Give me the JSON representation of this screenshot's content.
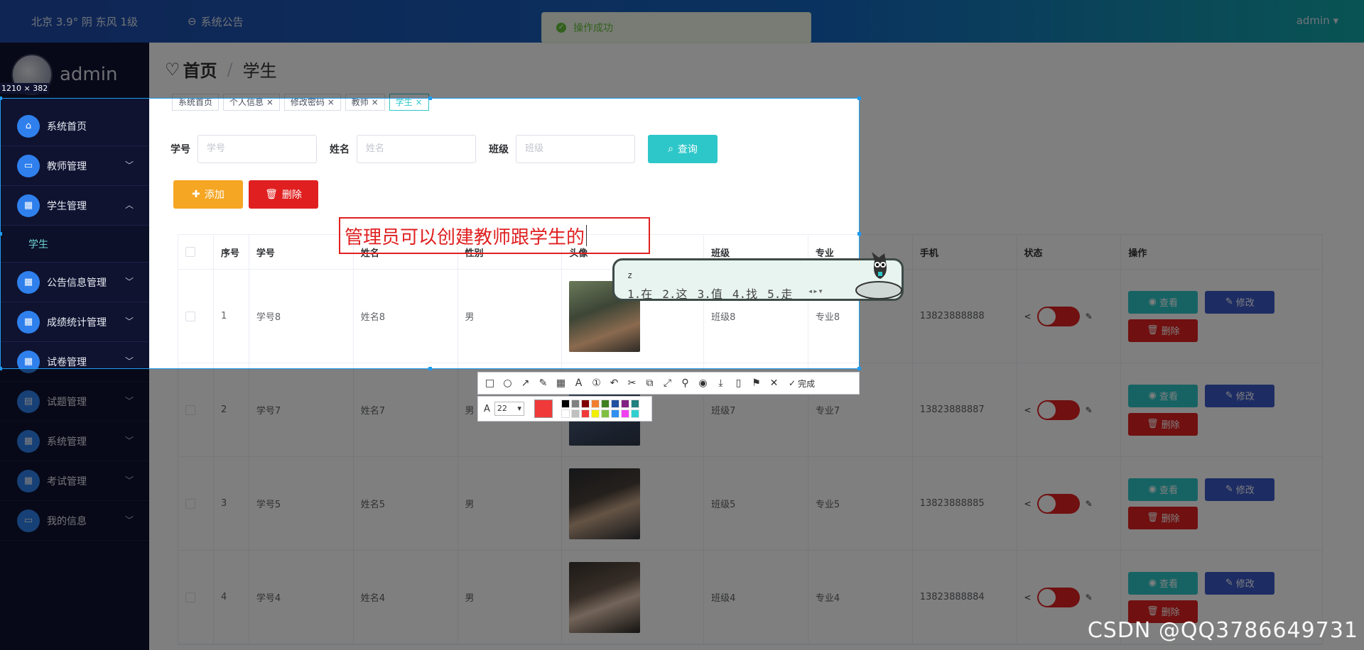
{
  "topbar": {
    "weather": "北京 3.9° 阴 东风 1级",
    "notice": "系统公告",
    "user": "admin ▾"
  },
  "toast": {
    "message": "操作成功"
  },
  "sidebar": {
    "username": "admin",
    "items": [
      {
        "label": "系统首页",
        "icon": "home-icon"
      },
      {
        "label": "教师管理",
        "icon": "monitor-icon"
      },
      {
        "label": "学生管理",
        "icon": "grid-icon",
        "open": true
      },
      {
        "label": "学生",
        "sub": true
      },
      {
        "label": "公告信息管理",
        "icon": "grid-icon"
      },
      {
        "label": "成绩统计管理",
        "icon": "grid-icon"
      },
      {
        "label": "试卷管理",
        "icon": "grid-icon"
      },
      {
        "label": "试题管理",
        "icon": "clipboard-icon"
      },
      {
        "label": "系统管理",
        "icon": "grid-icon"
      },
      {
        "label": "考试管理",
        "icon": "grid-icon"
      },
      {
        "label": "我的信息",
        "icon": "card-icon"
      }
    ]
  },
  "breadcrumb": {
    "home": "首页",
    "current": "学生"
  },
  "tags": [
    "系统首页",
    "个人信息 ×",
    "修改密码 ×",
    "教师 ×",
    "学生 ×"
  ],
  "search": {
    "fields": [
      {
        "label": "学号",
        "placeholder": "学号"
      },
      {
        "label": "姓名",
        "placeholder": "姓名"
      },
      {
        "label": "班级",
        "placeholder": "班级"
      }
    ],
    "button": "查询"
  },
  "actions": {
    "add": "添加",
    "delete": "删除"
  },
  "table": {
    "headers": [
      "",
      "序号",
      "学号",
      "姓名",
      "性别",
      "头像",
      "班级",
      "专业",
      "手机",
      "状态",
      "操作"
    ],
    "rows": [
      {
        "no": "1",
        "id": "学号8",
        "name": "姓名8",
        "gender": "男",
        "cls": "班级8",
        "major": "专业8",
        "phone": "13823888888"
      },
      {
        "no": "2",
        "id": "学号7",
        "name": "姓名7",
        "gender": "男",
        "cls": "班级7",
        "major": "专业7",
        "phone": "13823888887"
      },
      {
        "no": "3",
        "id": "学号5",
        "name": "姓名5",
        "gender": "男",
        "cls": "班级5",
        "major": "专业5",
        "phone": "13823888885"
      },
      {
        "no": "4",
        "id": "学号4",
        "name": "姓名4",
        "gender": "男",
        "cls": "班级4",
        "major": "专业4",
        "phone": "13823888884"
      }
    ],
    "ops": {
      "view": "查看",
      "edit": "修改",
      "delete": "删除"
    }
  },
  "capture": {
    "size": "1210 × 382",
    "annotation": "管理员可以创建教师跟学生的",
    "ime": {
      "composition": "z",
      "candidates": [
        "1.在",
        "2.这",
        "3.值",
        "4.找",
        "5.走"
      ]
    },
    "font_size": "22",
    "done": "完成",
    "palette": [
      "#000000",
      "#808080",
      "#800000",
      "#f08030",
      "#408020",
      "#2050a0",
      "#802080",
      "#208080",
      "#ffffff",
      "#c0c0c0",
      "#f03a3a",
      "#f0f000",
      "#80c040",
      "#3090f0",
      "#f040f0",
      "#30d0d0"
    ],
    "current_color": "#f03a3a"
  },
  "watermark": "CSDN @QQ3786649731"
}
